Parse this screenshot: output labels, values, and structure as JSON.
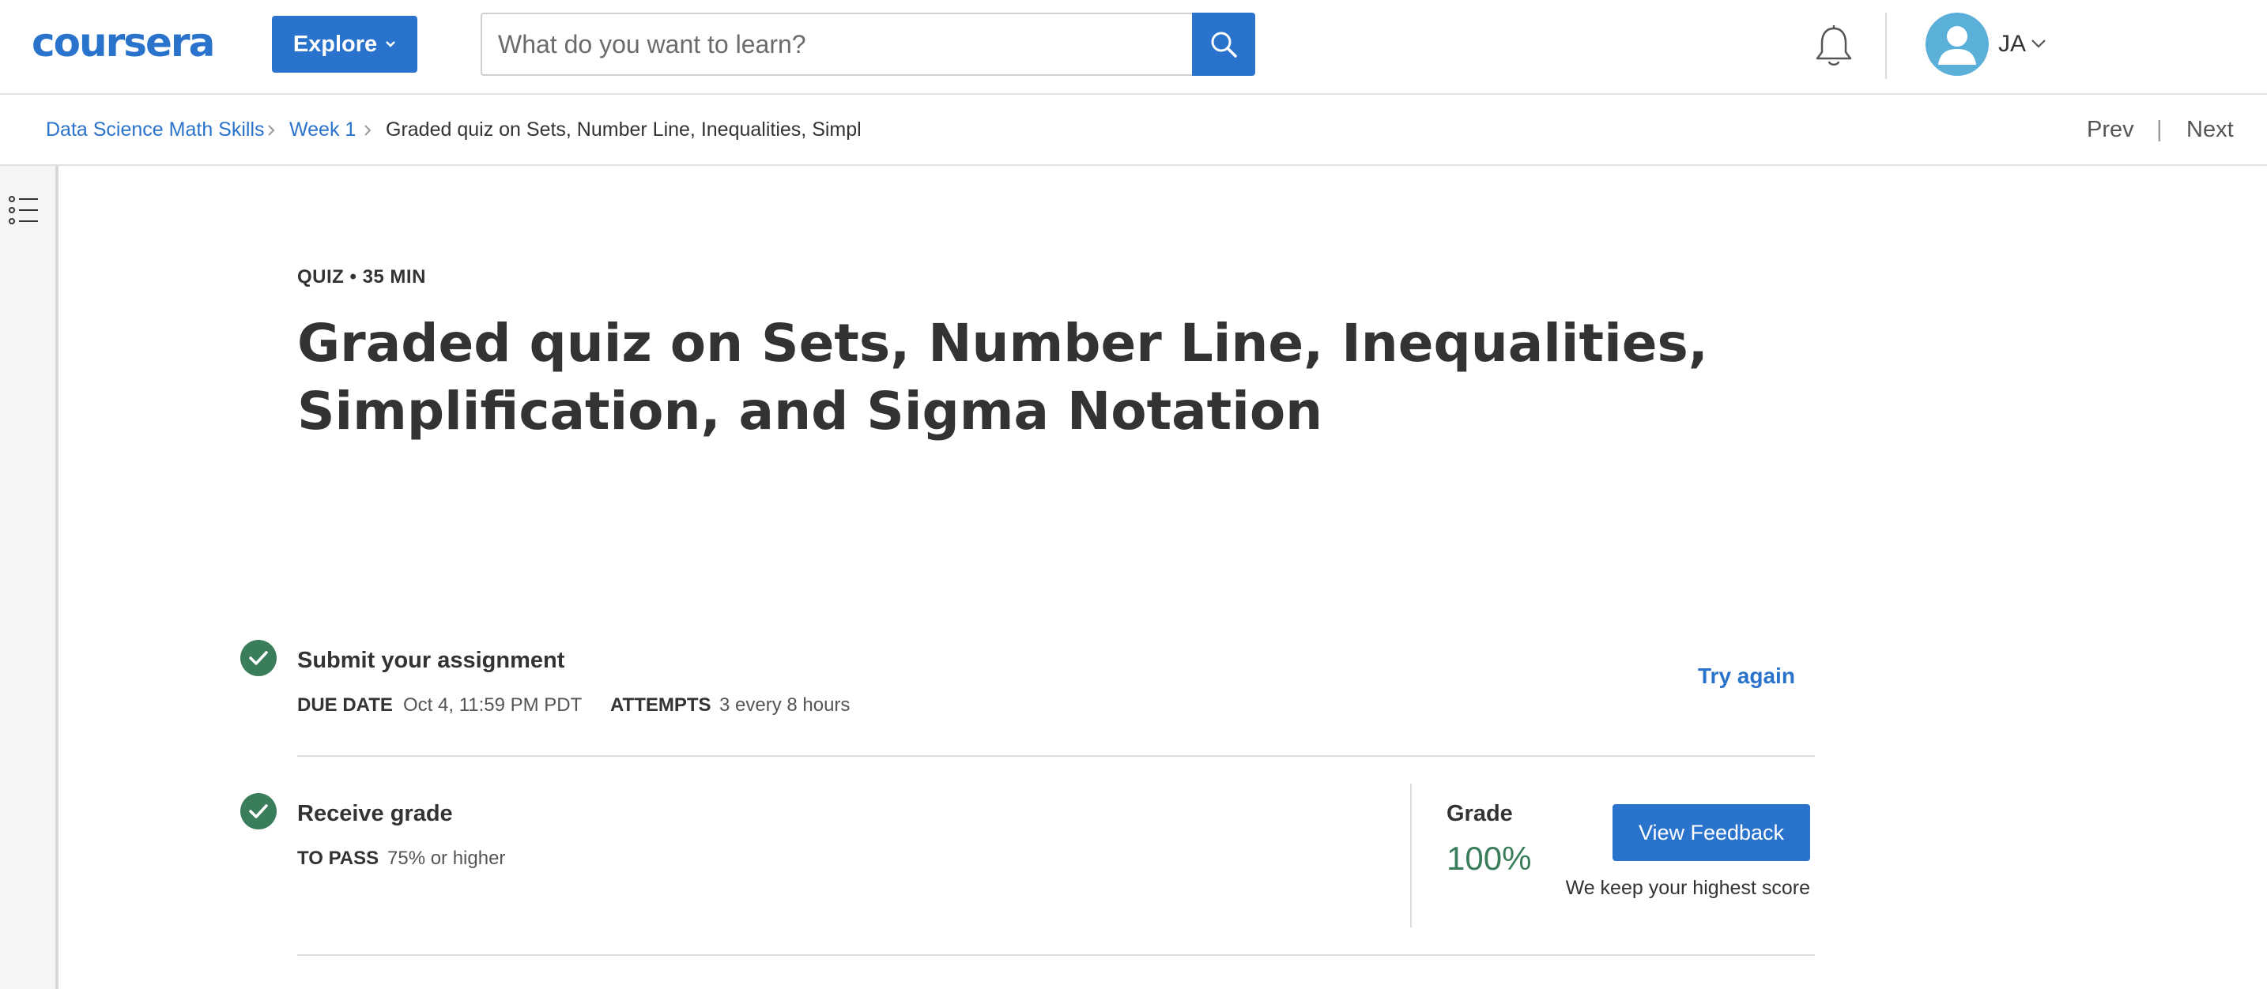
{
  "header": {
    "logo_text": "coursera",
    "explore_label": "Explore",
    "search_placeholder": "What do you want to learn?",
    "user_initials": "JA",
    "accent_color": "#2a73cc"
  },
  "breadcrumb": {
    "items": [
      "Data Science Math Skills",
      "Week 1"
    ],
    "current": "Graded quiz on Sets, Number Line, Inequalities, Simpl",
    "prev_label": "Prev",
    "separator": "|",
    "next_label": "Next"
  },
  "main": {
    "kicker": "QUIZ • 35 MIN",
    "title": "Graded quiz on Sets, Number Line, Inequalities, Simplification, and Sigma Notation",
    "submit": {
      "title": "Submit your assignment",
      "due_label": "DUE DATE",
      "due_value": "Oct 4, 11:59 PM PDT",
      "attempts_label": "ATTEMPTS",
      "attempts_value": "3 every 8 hours",
      "try_again_label": "Try again"
    },
    "grade": {
      "title": "Receive grade",
      "pass_label": "TO PASS",
      "pass_value": "75% or higher",
      "grade_label": "Grade",
      "grade_value": "100%",
      "feedback_button": "View Feedback",
      "note": "We keep your highest score",
      "success_color": "#3a7d5a"
    }
  },
  "icons": {
    "search": "search-icon",
    "bell": "bell-icon",
    "user": "user-icon",
    "toc": "list-icon",
    "check": "check-icon"
  }
}
